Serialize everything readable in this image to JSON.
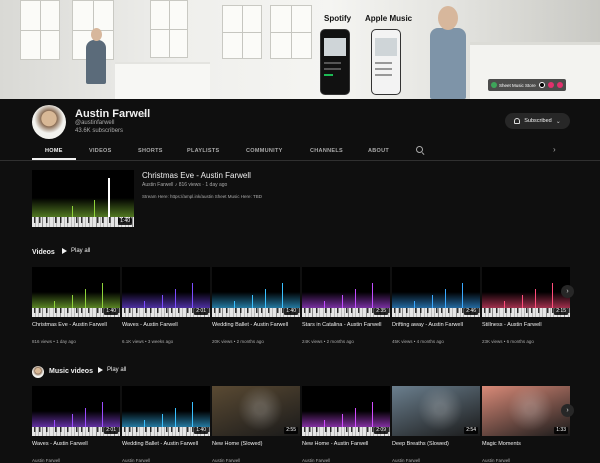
{
  "banner": {
    "spotify_label": "Spotify",
    "apple_music_label": "Apple Music",
    "links": [
      {
        "label": "Sheet Music Store",
        "color": "#3ea55a"
      },
      {
        "label": "",
        "color": "#111111"
      },
      {
        "label": "",
        "color": "#e1306c"
      },
      {
        "label": "",
        "color": "#e1306c"
      }
    ]
  },
  "channel": {
    "name": "Austin Farwell",
    "verified_icon": "music-note-icon",
    "handle": "@austinfarwell",
    "subscribers": "43.6K subscribers",
    "subscribe_label": "Subscribed"
  },
  "tabs": [
    "HOME",
    "VIDEOS",
    "SHORTS",
    "PLAYLISTS",
    "COMMUNITY",
    "CHANNELS",
    "ABOUT"
  ],
  "featured": {
    "title": "Christmas Eve - Austin Farwell",
    "channel": "Austin Farwell",
    "meta": "816 views · 1 day ago",
    "description": "Stream Here: https://ampl.ink/austin Sheet Music Here: TBD",
    "duration": "1:40"
  },
  "videos_section": {
    "title": "Videos",
    "play_all": "Play all",
    "items": [
      {
        "title": "Christmas Eve - Austin Farwell",
        "meta": "816 views • 1 day ago",
        "duration": "1:40",
        "color": "#8ed23a"
      },
      {
        "title": "Waves - Austin Farwell",
        "meta": "6.1K views • 3 weeks ago",
        "duration": "2:01",
        "color": "#7b4cff"
      },
      {
        "title": "Wedding Ballet - Austin Farwell",
        "meta": "20K views • 2 months ago",
        "duration": "1:40",
        "color": "#39c0ff"
      },
      {
        "title": "Stars in Catalina - Austin Farwell",
        "meta": "24K views • 2 months ago",
        "duration": "2:35",
        "color": "#c04cff"
      },
      {
        "title": "Drifting away - Austin Farwell",
        "meta": "45K views • 4 months ago",
        "duration": "2:46",
        "color": "#39a8ff"
      },
      {
        "title": "Stillness - Austin Farwell",
        "meta": "23K views • 6 months ago",
        "duration": "2:15",
        "color": "#ff4c7a"
      }
    ]
  },
  "music_section": {
    "title": "Music videos",
    "play_all": "Play all",
    "items": [
      {
        "title": "Waves - Austin Farwell",
        "meta": "Austin Farwell",
        "duration": "2:01",
        "kind": "piano",
        "color": "#9b4cff"
      },
      {
        "title": "Wedding Ballet - Austin Farwell",
        "meta": "Austin Farwell",
        "duration": "1:40",
        "kind": "piano",
        "color": "#39c0ff"
      },
      {
        "title": "New Home (Slowed)",
        "meta": "Austin Farwell",
        "duration": "2:55",
        "kind": "photo",
        "color": "#5a4a33"
      },
      {
        "title": "New Home - Austin Farwell",
        "meta": "Austin Farwell",
        "duration": "2:09",
        "kind": "piano",
        "color": "#d04cff"
      },
      {
        "title": "Deep Breaths (Slowed)",
        "meta": "Austin Farwell",
        "duration": "2:54",
        "kind": "photo",
        "color": "#6b7f8e"
      },
      {
        "title": "Magic Moments",
        "meta": "Austin Farwell",
        "duration": "1:33",
        "kind": "photo",
        "color": "#d98a78"
      }
    ]
  }
}
